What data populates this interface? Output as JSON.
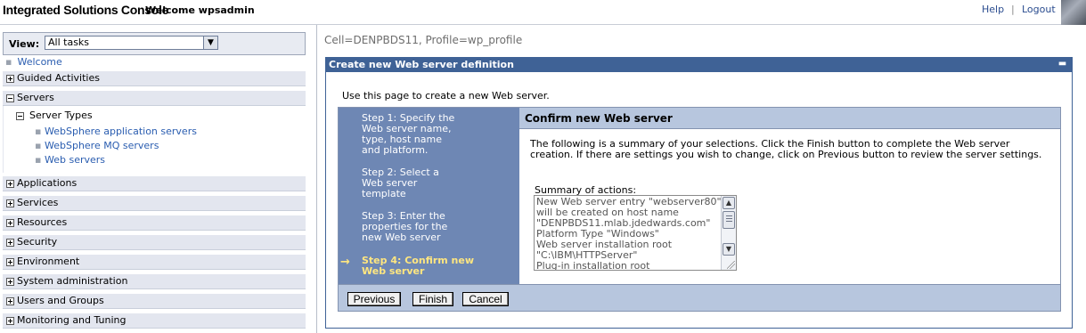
{
  "header": {
    "app_title": "Integrated Solutions Console",
    "welcome": "Welcome wpsadmin",
    "help": "Help",
    "separator": "|",
    "logout": "Logout"
  },
  "nav": {
    "view_label": "View:",
    "view_value": "All tasks",
    "welcome_link": "Welcome",
    "items": [
      {
        "label": "Guided Activities",
        "expanded": false
      },
      {
        "label": "Servers",
        "expanded": true
      },
      {
        "label": "Applications",
        "expanded": false
      },
      {
        "label": "Services",
        "expanded": false
      },
      {
        "label": "Resources",
        "expanded": false
      },
      {
        "label": "Security",
        "expanded": false
      },
      {
        "label": "Environment",
        "expanded": false
      },
      {
        "label": "System administration",
        "expanded": false
      },
      {
        "label": "Users and Groups",
        "expanded": false
      },
      {
        "label": "Monitoring and Tuning",
        "expanded": false
      }
    ],
    "server_types": {
      "title": "Server Types",
      "links": [
        "WebSphere application servers",
        "WebSphere MQ servers",
        "Web servers"
      ]
    }
  },
  "main": {
    "cell_profile": "Cell=DENPBDS11, Profile=wp_profile",
    "panel_title": "Create new Web server definition",
    "intro": "Use this page to create a new Web server.",
    "steps": [
      [
        "Step 1: Specify the",
        "Web server name,",
        "type, host name",
        "and platform."
      ],
      [
        "Step 2: Select a",
        "Web server",
        "template"
      ],
      [
        "Step 3: Enter the",
        "properties for the",
        "new Web server"
      ],
      [
        "Step 4: Confirm new",
        "Web server"
      ]
    ],
    "confirm_title": "Confirm new Web server",
    "summary_line1": "The following is a summary of your selections. Click the Finish button to complete the Web server",
    "summary_line2": "creation. If there are settings you wish to change, click on Previous button to review the server settings.",
    "summary_label": "Summary of actions:",
    "summary_lines": [
      "New Web server entry \"webserver80\"",
      "will be created on host name",
      "\"DENPBDS11.mlab.jdedwards.com\"",
      "Platform Type \"Windows\"",
      "Web server installation root",
      "\"C:\\IBM\\HTTPServer\"",
      "Plug-in installation root"
    ],
    "buttons": {
      "previous": "Previous",
      "finish": "Finish",
      "cancel": "Cancel"
    }
  }
}
